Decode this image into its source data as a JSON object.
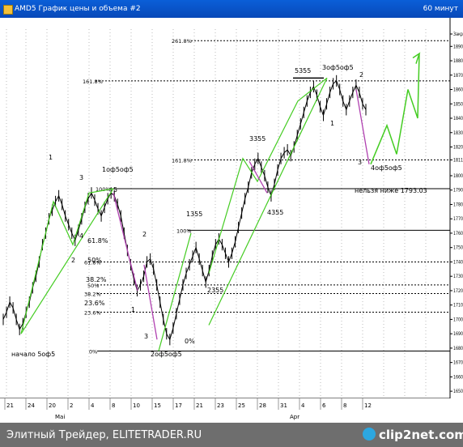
{
  "window": {
    "title": "AMD5 График цены и объема #2",
    "timeframe": "60 минут"
  },
  "footer": {
    "left_text": "Элитный Трейдер, ELITETRADER.RU",
    "logo": "clip2net.com"
  },
  "chart_data": {
    "type": "line",
    "title": "",
    "xlabel": "",
    "ylabel": "",
    "ylim": [
      1640,
      1900
    ],
    "grid": true,
    "y_ticks": [
      1900,
      1890,
      1880,
      1870,
      1860,
      1850,
      1840,
      1830,
      1820,
      1811,
      1800,
      1790,
      1780,
      1770,
      1760,
      1750,
      1740,
      1730,
      1720,
      1710,
      1700,
      1690,
      1680,
      1670,
      1660,
      1650
    ],
    "y_tick_labels": [
      "Закр",
      "1890",
      "1880",
      "1870",
      "1860",
      "1850",
      "1840",
      "1830",
      "1820",
      "1811",
      "1800",
      "1790",
      "1780",
      "1770",
      "1760",
      "1750",
      "1740",
      "1730",
      "1720",
      "1710",
      "1700",
      "1690",
      "1680",
      "1670",
      "1660",
      "1650"
    ],
    "x_ticks": [
      "21",
      "24",
      "20",
      "2",
      "4",
      "8",
      "10",
      "15",
      "17",
      "21",
      "23",
      "25",
      "28",
      "31",
      "4",
      "6",
      "8",
      "12"
    ],
    "x_month_labels": [
      "Маі",
      "Apr"
    ],
    "series": [
      {
        "values": [
          1700,
          1705,
          1712,
          1708,
          1700,
          1693,
          1697,
          1705,
          1712,
          1722,
          1730,
          1740,
          1752,
          1760,
          1770,
          1776,
          1782,
          1786,
          1780,
          1772,
          1766,
          1760,
          1755,
          1762,
          1770,
          1778,
          1784,
          1788,
          1783,
          1777,
          1772,
          1778,
          1784,
          1788,
          1786,
          1780,
          1772,
          1760,
          1748,
          1738,
          1728,
          1720,
          1724,
          1730,
          1740,
          1742,
          1735,
          1724,
          1712,
          1700,
          1690,
          1686,
          1694,
          1704,
          1714,
          1724,
          1732,
          1738,
          1744,
          1750,
          1742,
          1734,
          1726,
          1734,
          1744,
          1752,
          1756,
          1752,
          1746,
          1740,
          1746,
          1754,
          1764,
          1774,
          1784,
          1792,
          1802,
          1808,
          1812,
          1806,
          1800,
          1792,
          1786,
          1794,
          1804,
          1812,
          1816,
          1818,
          1814,
          1820,
          1828,
          1836,
          1844,
          1852,
          1858,
          1862,
          1856,
          1848,
          1842,
          1850,
          1858,
          1864,
          1866,
          1860,
          1852,
          1846,
          1852,
          1858,
          1863,
          1858,
          1850,
          1846
        ]
      },
      {
        "values": [
          1690,
          1791
        ]
      },
      {
        "values": [
          1678,
          1760
        ]
      },
      {
        "values": [
          1696,
          1868
        ]
      },
      {
        "values": [
          1808,
          1835,
          1815,
          1860,
          1840,
          1885
        ]
      }
    ],
    "horizontal_levels": [
      {
        "value": 1894,
        "label": "261.8%"
      },
      {
        "value": 1866,
        "label": "161.8%"
      },
      {
        "value": 1811,
        "label": "161.8%"
      },
      {
        "value": 1791,
        "label": "100%"
      },
      {
        "value": 1762,
        "label": "100%"
      },
      {
        "value": 1740,
        "label": "61.8%"
      },
      {
        "value": 1724,
        "label": "50%"
      },
      {
        "value": 1718,
        "label": "38.2%"
      },
      {
        "value": 1705,
        "label": "23.6%"
      },
      {
        "value": 1678,
        "label": "0%"
      }
    ],
    "annotations": [
      "1",
      "3",
      "1оф5оф5",
      "5",
      "4",
      "2",
      "2",
      "1",
      "3",
      "2оф5оф5",
      "1355",
      "2355",
      "3355",
      "4355",
      "5355",
      "3оф5оф5",
      "1",
      "2",
      "3",
      "4оф5оф5",
      "нельзя ниже 1793.03",
      "начало 5оф5",
      "61.8%",
      "50%",
      "38.2%",
      "23.6%",
      "0%"
    ]
  }
}
